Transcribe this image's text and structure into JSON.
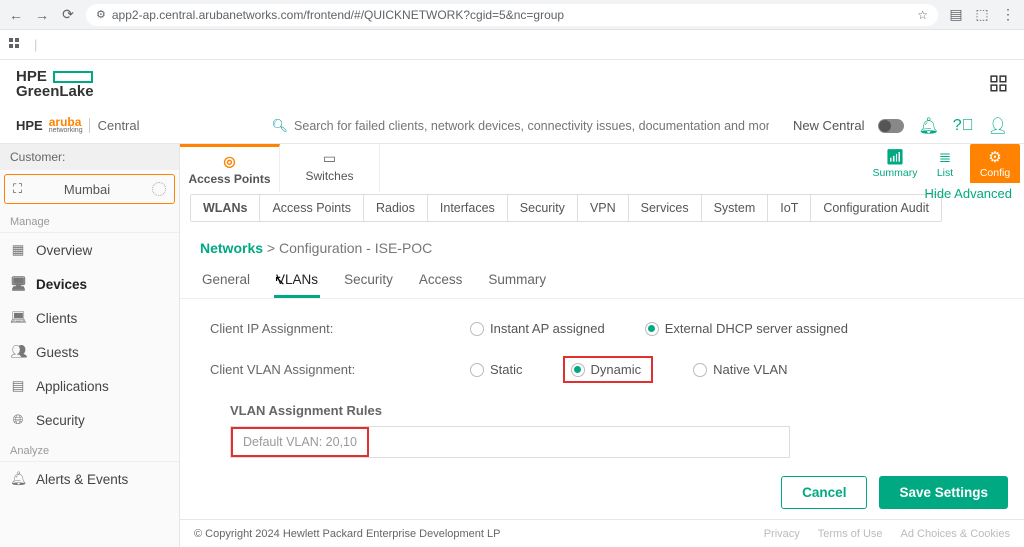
{
  "browser": {
    "url": "app2-ap.central.arubanetworks.com/frontend/#/QUICKNETWORK?cgid=5&nc=group"
  },
  "hpe_brand_top": "HPE",
  "hpe_brand_bottom": "GreenLake",
  "aruba_brand_bold": "HPE",
  "aruba_brand_orange": "aruba",
  "aruba_brand_sub": "networking",
  "aruba_central": "Central",
  "search_placeholder": "Search for failed clients, network devices, connectivity issues, documentation and more",
  "new_central": "New Central",
  "leftcol": {
    "customer_label": "Customer:",
    "location": "Mumbai",
    "manage_label": "Manage",
    "analyze_label": "Analyze",
    "items": {
      "overview": "Overview",
      "devices": "Devices",
      "clients": "Clients",
      "guests": "Guests",
      "applications": "Applications",
      "security": "Security",
      "alerts": "Alerts & Events"
    }
  },
  "device_tabs": {
    "ap": "Access Points",
    "sw": "Switches"
  },
  "view_actions": {
    "summary": "Summary",
    "list": "List",
    "config": "Config"
  },
  "subtabs": [
    "WLANs",
    "Access Points",
    "Radios",
    "Interfaces",
    "Security",
    "VPN",
    "Services",
    "System",
    "IoT",
    "Configuration Audit"
  ],
  "hide_advanced": "Hide Advanced",
  "breadcrumb": {
    "networks": "Networks",
    "sep": " > ",
    "current": "Configuration - ISE-POC"
  },
  "config_tabs": [
    "General",
    "VLANs",
    "Security",
    "Access",
    "Summary"
  ],
  "form": {
    "ip_label": "Client IP Assignment:",
    "ip_opts": {
      "iap": "Instant AP assigned",
      "ext": "External DHCP server assigned"
    },
    "vlan_label": "Client VLAN Assignment:",
    "vlan_opts": {
      "static": "Static",
      "dynamic": "Dynamic",
      "native": "Native VLAN"
    },
    "rules_heading": "VLAN Assignment Rules",
    "default_vlan": "Default VLAN: 20,10"
  },
  "buttons": {
    "cancel": "Cancel",
    "save": "Save Settings"
  },
  "footer": {
    "copyright": "© Copyright 2024 Hewlett Packard Enterprise Development LP",
    "links": [
      "Privacy",
      "Terms of Use",
      "Ad Choices & Cookies"
    ]
  }
}
